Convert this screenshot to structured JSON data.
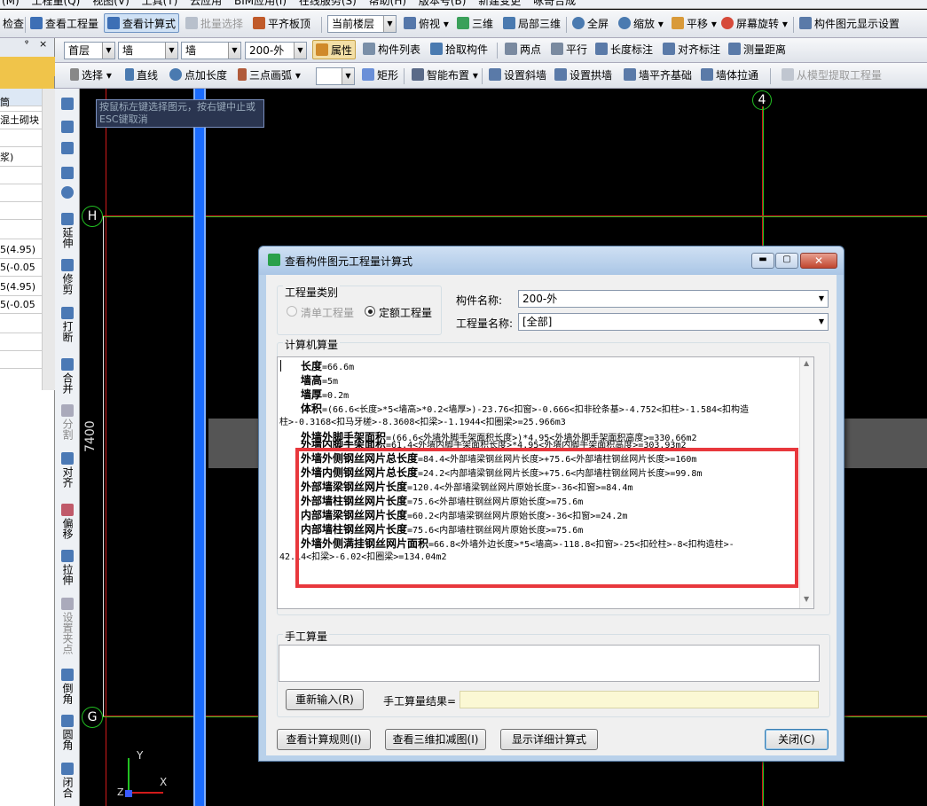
{
  "menubar": {
    "items": [
      "(M)",
      "工程量(Q)",
      "视图(V)",
      "工具(T)",
      "云应用",
      "BIM应用(I)",
      "在线服务(S)",
      "帮助(H)",
      "版本号(B)",
      "新建变更",
      "咏哥合成"
    ]
  },
  "toolbar1": {
    "check_label": "检查",
    "view_quantity_label": "查看工程量",
    "view_formula_label": "查看计算式",
    "batch_select_label": "批量选择",
    "flush_slab_label": "平齐板顶",
    "floor_select": "当前楼层",
    "top_view_label": "俯视",
    "three_d_label": "三维",
    "local_3d_label": "局部三维",
    "fullscreen_label": "全屏",
    "zoom_label": "缩放",
    "pan_label": "平移",
    "rotate_label": "屏幕旋转",
    "display_settings_label": "构件图元显示设置"
  },
  "toolbar2": {
    "floor_value": "首层",
    "category_value": "墙",
    "type_value": "墙",
    "component_value": "200-外",
    "properties_label": "属性",
    "component_list_label": "构件列表",
    "pick_component_label": "拾取构件",
    "two_points_label": "两点",
    "parallel_label": "平行",
    "length_dim_label": "长度标注",
    "aligned_dim_label": "对齐标注",
    "measure_label": "测量距离"
  },
  "toolbar3": {
    "select_label": "选择",
    "line_label": "直线",
    "point_length_label": "点加长度",
    "three_point_arc_label": "三点画弧",
    "rect_label": "矩形",
    "smart_layout_label": "智能布置",
    "slope_wall_label": "设置斜墙",
    "arch_wall_label": "设置拱墙",
    "wall_base_label": "墙平齐基础",
    "wall_stretch_label": "墙体拉通",
    "extract_label": "从模型提取工程量"
  },
  "left_panel": {
    "rows": [
      "筒",
      "混土砌块",
      "",
      "浆)",
      "",
      "",
      "",
      "",
      "5(4.95)",
      "5(-0.05",
      "5(4.95)",
      "5(-0.05",
      "",
      "",
      ""
    ]
  },
  "vertical_tools": [
    {
      "icon": "brush-icon",
      "label": ""
    },
    {
      "icon": "copy-icon",
      "label": ""
    },
    {
      "icon": "mirror-icon",
      "label": ""
    },
    {
      "icon": "move-icon",
      "label": ""
    },
    {
      "icon": "rotate-icon",
      "label": ""
    },
    {
      "icon": "extend-icon",
      "label": "延伸"
    },
    {
      "icon": "trim-icon",
      "label": "修剪"
    },
    {
      "icon": "break-icon",
      "label": "打断"
    },
    {
      "icon": "merge-icon",
      "label": "合并"
    },
    {
      "icon": "split-icon",
      "label": "分割"
    },
    {
      "icon": "align-icon",
      "label": "对齐"
    },
    {
      "icon": "offset-icon",
      "label": "偏移"
    },
    {
      "icon": "stretch-icon",
      "label": "拉伸"
    },
    {
      "icon": "grip-icon",
      "label": "设置夹点"
    },
    {
      "icon": "chamfer-icon",
      "label": "倒角"
    },
    {
      "icon": "fillet-icon",
      "label": "圆角"
    },
    {
      "icon": "close-shape-icon",
      "label": "闭合"
    }
  ],
  "canvas": {
    "hint": "按鼠标左键选择图元，按右键中止或ESC键取消",
    "axis_4": "4",
    "axis_H": "H",
    "axis_G": "G",
    "dimension": "7400",
    "ucs_x": "X",
    "ucs_y": "Y",
    "ucs_z": "Z"
  },
  "dialog": {
    "title": "查看构件图元工程量计算式",
    "quantity_type_group": "工程量类别",
    "radio_list": "清单工程量",
    "radio_quota": "定额工程量",
    "component_name_label": "构件名称:",
    "component_name_value": "200-外",
    "quantity_name_label": "工程量名称:",
    "quantity_name_value": "[全部]",
    "computer_calc_label": "计算机算量",
    "formula_lines": [
      {
        "name": "长度",
        "expr": "=66.6m"
      },
      {
        "name": "墙高",
        "expr": "=5m"
      },
      {
        "name": "墙厚",
        "expr": "=0.2m"
      },
      {
        "name": "体积",
        "expr": "=(66.6<长度>*5<墙高>*0.2<墙厚>)-23.76<扣窗>-0.666<扣非砼条基>-4.752<扣柱>-1.584<扣构造"
      },
      {
        "name": "",
        "expr": "柱>-0.3168<扣马牙槎>-8.3608<扣梁>-1.1944<扣圈梁>=25.966m3"
      },
      {
        "name": "外墙外脚手架面积",
        "expr": "=(66.6<外墙外脚手架面积长度>)*4.95<外墙外脚手架面积高度>=330.66m2"
      },
      {
        "name": "外墙内脚手架面积",
        "expr": "=61.4<外墙内脚手架面积长度>*4.95<外墙内脚手架面积高度>=303.93m2"
      },
      {
        "name": "外墙外侧钢丝网片总长度",
        "expr": "=84.4<外部墙梁钢丝网片长度>+75.6<外部墙柱钢丝网片长度>=160m"
      },
      {
        "name": "外墙内侧钢丝网片总长度",
        "expr": "=24.2<内部墙梁钢丝网片长度>+75.6<内部墙柱钢丝网片长度>=99.8m"
      },
      {
        "name": "外部墙梁钢丝网片长度",
        "expr": "=120.4<外部墙梁钢丝网片原始长度>-36<扣窗>=84.4m"
      },
      {
        "name": "外部墙柱钢丝网片长度",
        "expr": "=75.6<外部墙柱钢丝网片原始长度>=75.6m"
      },
      {
        "name": "内部墙梁钢丝网片长度",
        "expr": "=60.2<内部墙梁钢丝网片原始长度>-36<扣窗>=24.2m"
      },
      {
        "name": "内部墙柱钢丝网片长度",
        "expr": "=75.6<内部墙柱钢丝网片原始长度>=75.6m"
      },
      {
        "name": "外墙外侧满挂钢丝网片面积",
        "expr": "=66.8<外墙外边长度>*5<墙高>-118.8<扣窗>-25<扣砼柱>-8<扣构造柱>-"
      },
      {
        "name": "",
        "expr": "42.14<扣梁>-6.02<扣圈梁>=134.04m2"
      }
    ],
    "manual_calc_label": "手工算量",
    "reenter_button": "重新输入(R)",
    "manual_result_label": "手工算量结果=",
    "view_rules_button": "查看计算规则(I)",
    "view_3d_deduct_button": "查看三维扣减图(I)",
    "show_detail_button": "显示详细计算式",
    "close_button": "关闭(C)"
  },
  "colors": {
    "highlight_box": "#e8383d",
    "wall_blue": "#1a6cff",
    "grid_red": "#d11a1a",
    "grid_green": "#22c022"
  }
}
